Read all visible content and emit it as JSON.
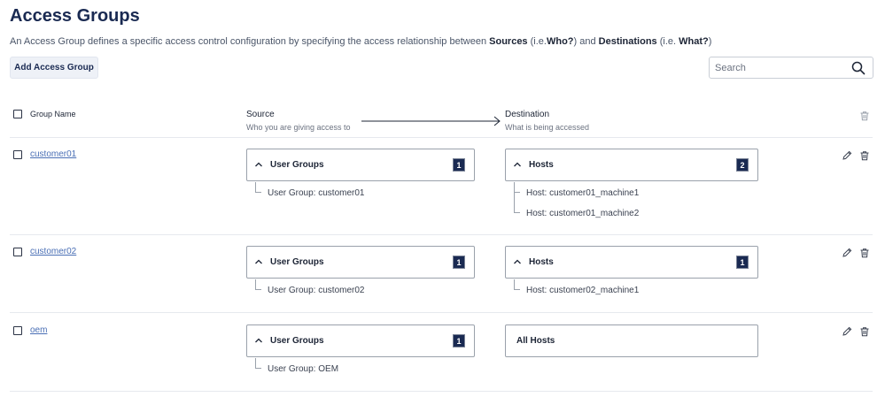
{
  "page": {
    "title": "Access Groups",
    "description_parts": [
      "An Access Group defines a specific access control configuration by specifying the access relationship between ",
      "Sources",
      " (i.e.",
      "Who?",
      ") and ",
      "Destinations",
      " (i.e. ",
      "What?",
      ")"
    ]
  },
  "toolbar": {
    "add_label": "Add Access Group",
    "search_placeholder": "Search",
    "search_value": ""
  },
  "table": {
    "header": {
      "group_name": "Group Name",
      "source_title": "Source",
      "source_subtitle": "Who you are giving access to",
      "destination_title": "Destination",
      "destination_subtitle": "What is being accessed"
    },
    "rows": [
      {
        "name": "customer01",
        "source": {
          "title": "User Groups",
          "count": "1",
          "items": [
            "User Group: customer01"
          ]
        },
        "destination": {
          "title": "Hosts",
          "count": "2",
          "items": [
            "Host: customer01_machine1",
            "Host: customer01_machine2"
          ]
        }
      },
      {
        "name": "customer02",
        "source": {
          "title": "User Groups",
          "count": "1",
          "items": [
            "User Group: customer02"
          ]
        },
        "destination": {
          "title": "Hosts",
          "count": "1",
          "items": [
            "Host: customer02_machine1"
          ]
        }
      },
      {
        "name": "oem",
        "source": {
          "title": "User Groups",
          "count": "1",
          "items": [
            "User Group: OEM"
          ]
        },
        "destination": {
          "title": "All Hosts"
        }
      }
    ]
  },
  "colors": {
    "title": "#1a2a52",
    "badge": "#1a2a52",
    "link": "#4a6fb5",
    "divider": "#e6e9ee"
  },
  "icons": [
    "search-icon",
    "chevron-up-icon",
    "pencil-icon",
    "trash-icon",
    "arrow-right-icon"
  ]
}
